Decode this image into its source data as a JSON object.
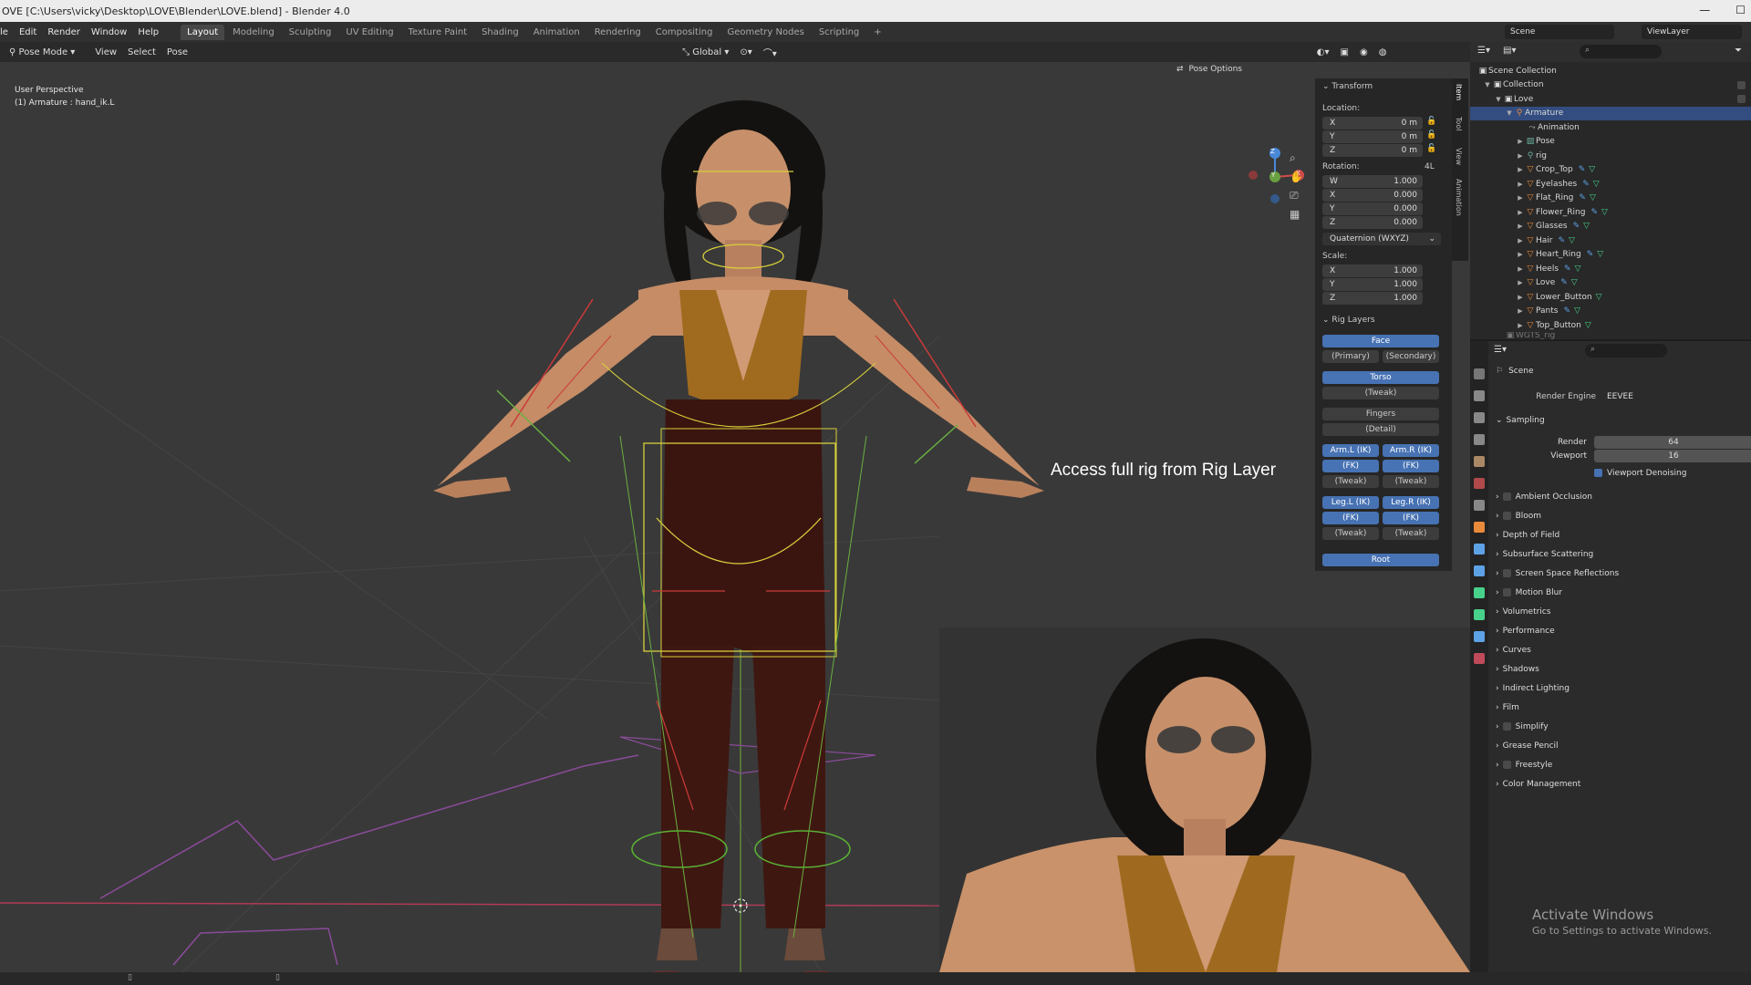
{
  "window": {
    "title": "OVE [C:\\Users\\vicky\\Desktop\\LOVE\\Blender\\LOVE.blend] - Blender 4.0",
    "controls": [
      "—",
      "☐"
    ]
  },
  "menu": [
    "le",
    "Edit",
    "Render",
    "Window",
    "Help"
  ],
  "workspaces": {
    "active": "Layout",
    "tabs": [
      "Layout",
      "Modeling",
      "Sculpting",
      "UV Editing",
      "Texture Paint",
      "Shading",
      "Animation",
      "Rendering",
      "Compositing",
      "Geometry Nodes",
      "Scripting",
      "+"
    ]
  },
  "scene_selector": {
    "scene": "Scene",
    "view_layer": "ViewLayer"
  },
  "viewport_header": {
    "mode": "Pose Mode",
    "menus": [
      "View",
      "Select",
      "Pose"
    ],
    "orientation": "Global",
    "pose_options": "Pose Options"
  },
  "viewport": {
    "perspective": "User Perspective",
    "active": "(1) Armature : hand_ik.L",
    "annotation": "Access full rig from Rig Layer",
    "gizmo": {
      "x": "X",
      "y": "Y",
      "z": "Z"
    }
  },
  "sidebar_tabs": [
    "Item",
    "Tool",
    "View",
    "Animation"
  ],
  "transform": {
    "title": "Transform",
    "location_label": "Location:",
    "location": [
      {
        "axis": "X",
        "value": "0 m"
      },
      {
        "axis": "Y",
        "value": "0 m"
      },
      {
        "axis": "Z",
        "value": "0 m"
      }
    ],
    "rotation_label": "Rotation:",
    "rotation_mode_tag": "4L",
    "rotation": [
      {
        "axis": "W",
        "value": "1.000"
      },
      {
        "axis": "X",
        "value": "0.000"
      },
      {
        "axis": "Y",
        "value": "0.000"
      },
      {
        "axis": "Z",
        "value": "0.000"
      }
    ],
    "rotation_mode": "Quaternion (WXYZ)",
    "scale_label": "Scale:",
    "scale": [
      {
        "axis": "X",
        "value": "1.000"
      },
      {
        "axis": "Y",
        "value": "1.000"
      },
      {
        "axis": "Z",
        "value": "1.000"
      }
    ]
  },
  "rig_layers": {
    "title": "Rig Layers",
    "face": "Face",
    "primary": "(Primary)",
    "secondary": "(Secondary)",
    "torso": "Torso",
    "torso_tweak": "(Tweak)",
    "fingers": "Fingers",
    "detail": "(Detail)",
    "arm_l_ik": "Arm.L (IK)",
    "arm_r_ik": "Arm.R (IK)",
    "arm_l_fk": "(FK)",
    "arm_r_fk": "(FK)",
    "arm_l_tweak": "(Tweak)",
    "arm_r_tweak": "(Tweak)",
    "leg_l_ik": "Leg.L (IK)",
    "leg_r_ik": "Leg.R (IK)",
    "leg_l_fk": "(FK)",
    "leg_r_fk": "(FK)",
    "leg_l_tweak": "(Tweak)",
    "leg_r_tweak": "(Tweak)",
    "root": "Root"
  },
  "outliner": {
    "rows": [
      {
        "label": "Scene Collection"
      },
      {
        "label": "Collection"
      },
      {
        "label": "Love"
      },
      {
        "label": "Armature"
      },
      {
        "label": "Animation"
      },
      {
        "label": "Pose"
      },
      {
        "label": "rig"
      },
      {
        "label": "Crop_Top"
      },
      {
        "label": "Eyelashes"
      },
      {
        "label": "Flat_Ring"
      },
      {
        "label": "Flower_Ring"
      },
      {
        "label": "Glasses"
      },
      {
        "label": "Hair"
      },
      {
        "label": "Heart_Ring"
      },
      {
        "label": "Heels"
      },
      {
        "label": "Love"
      },
      {
        "label": "Lower_Button"
      },
      {
        "label": "Pants"
      },
      {
        "label": "Top_Button"
      },
      {
        "label": "WGTS_rig"
      }
    ]
  },
  "properties": {
    "context": "Scene",
    "render_engine_label": "Render Engine",
    "render_engine": "EEVEE",
    "sampling": "Sampling",
    "render_label": "Render",
    "render_samples": "64",
    "viewport_label": "Viewport",
    "viewport_samples": "16",
    "viewport_denoising": "Viewport Denoising",
    "panels": [
      "Ambient Occlusion",
      "Bloom",
      "Depth of Field",
      "Subsurface Scattering",
      "Screen Space Reflections",
      "Motion Blur",
      "Volumetrics",
      "Performance",
      "Curves",
      "Shadows",
      "Indirect Lighting",
      "Film",
      "Simplify",
      "Grease Pencil",
      "Freestyle",
      "Color Management"
    ]
  },
  "watermark": {
    "title": "Activate Windows",
    "subtitle": "Go to Settings to activate Windows."
  }
}
